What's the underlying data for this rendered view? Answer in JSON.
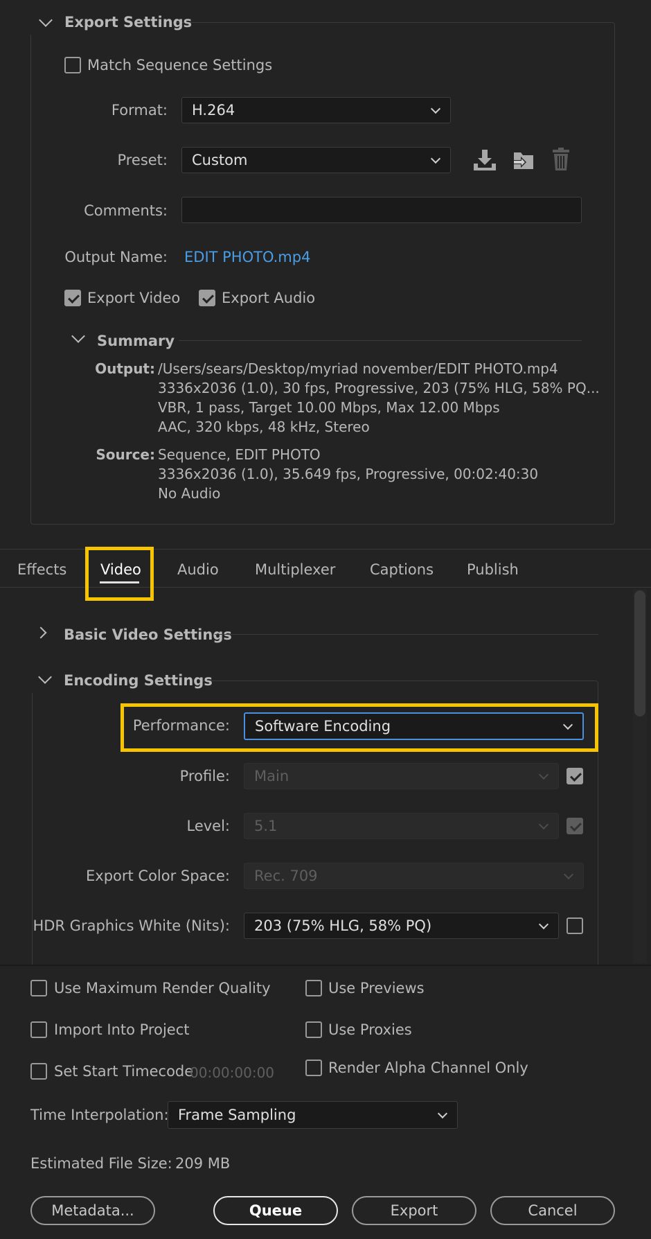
{
  "export_settings": {
    "title": "Export Settings",
    "match_sequence_label": "Match Sequence Settings",
    "format_label": "Format:",
    "format_value": "H.264",
    "preset_label": "Preset:",
    "preset_value": "Custom",
    "comments_label": "Comments:",
    "comments_value": "",
    "output_name_label": "Output Name:",
    "output_name_value": "EDIT PHOTO.mp4",
    "export_video_label": "Export Video",
    "export_audio_label": "Export Audio"
  },
  "summary": {
    "title": "Summary",
    "output_label": "Output:",
    "output_lines": [
      "/Users/sears/Desktop/myriad november/EDIT PHOTO.mp4",
      "3336x2036 (1.0), 30 fps, Progressive, 203 (75% HLG, 58% PQ...",
      "VBR, 1 pass, Target 10.00 Mbps, Max 12.00 Mbps",
      "AAC, 320 kbps, 48 kHz, Stereo"
    ],
    "source_label": "Source:",
    "source_lines": [
      "Sequence, EDIT PHOTO",
      "3336x2036 (1.0), 35.649 fps, Progressive, 00:02:40:30",
      "No Audio"
    ]
  },
  "tabs": [
    "Effects",
    "Video",
    "Audio",
    "Multiplexer",
    "Captions",
    "Publish"
  ],
  "active_tab": "Video",
  "video": {
    "basic_video_settings": "Basic Video Settings",
    "encoding_settings": "Encoding Settings",
    "performance_label": "Performance:",
    "performance_value": "Software Encoding",
    "profile_label": "Profile:",
    "profile_value": "Main",
    "level_label": "Level:",
    "level_value": "5.1",
    "color_space_label": "Export Color Space:",
    "color_space_value": "Rec. 709",
    "hdr_label": "HDR Graphics White (Nits):",
    "hdr_value": "203 (75% HLG, 58% PQ)"
  },
  "bottom": {
    "use_max_render_quality": "Use Maximum Render Quality",
    "use_previews": "Use Previews",
    "import_into_project": "Import Into Project",
    "use_proxies": "Use Proxies",
    "set_start_timecode": "Set Start Timecode",
    "start_timecode_value": "00:00:00:00",
    "render_alpha_only": "Render Alpha Channel Only",
    "time_interpolation_label": "Time Interpolation:",
    "time_interpolation_value": "Frame Sampling",
    "estimated_size_label": "Estimated File Size:",
    "estimated_size_value": "209 MB",
    "metadata_button": "Metadata...",
    "queue_button": "Queue",
    "export_button": "Export",
    "cancel_button": "Cancel"
  },
  "colors": {
    "highlight": "#f7c500",
    "link": "#4a9ee8",
    "focus": "#4a90e2"
  }
}
